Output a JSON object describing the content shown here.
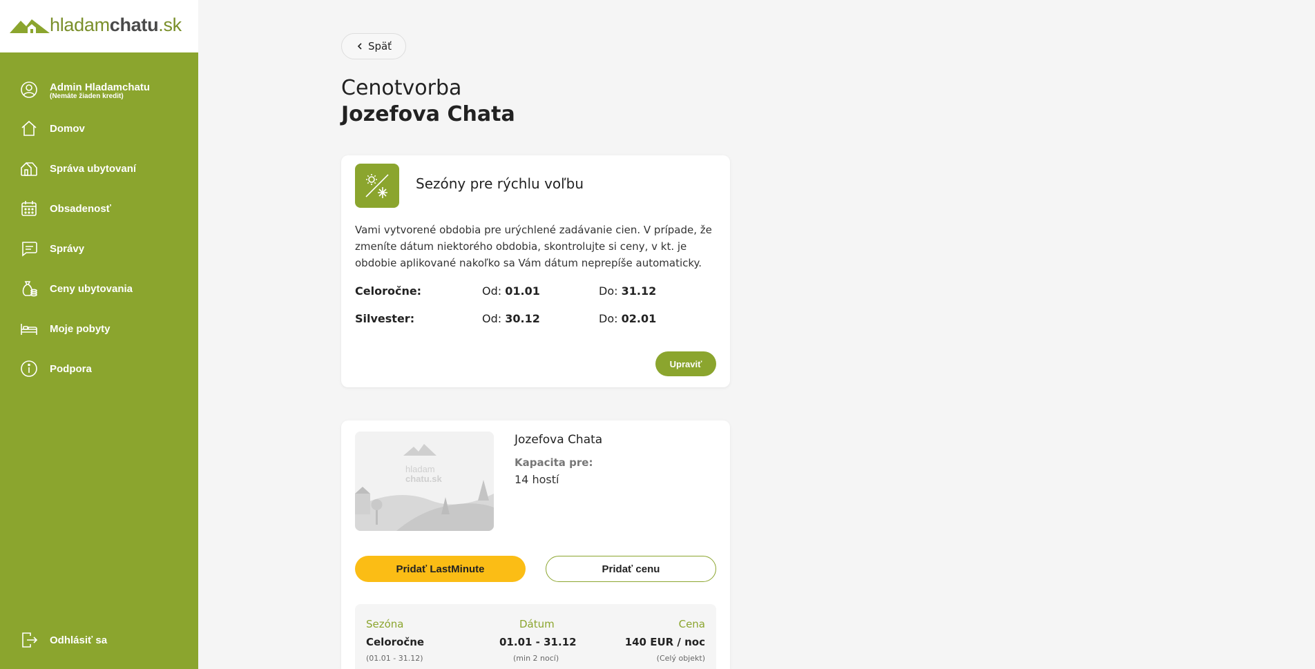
{
  "brand": {
    "logo_light": "hladam",
    "logo_bold": "chatu",
    "logo_tld": ".sk"
  },
  "user": {
    "name": "Admin Hladamchatu",
    "credit": "(Nemáte žiaden kredit)"
  },
  "nav": {
    "home": "Domov",
    "accommodation": "Správa ubytovaní",
    "occupancy": "Obsadenosť",
    "messages": "Správy",
    "prices": "Ceny ubytovania",
    "stays": "Moje pobyty",
    "support": "Podpora",
    "logout": "Odhlásiť sa"
  },
  "back_label": "Späť",
  "page": {
    "title": "Cenotvorba",
    "subtitle": "Jozefova Chata"
  },
  "seasons_card": {
    "title": "Sezóny pre rýchlu voľbu",
    "description": "Vami vytvorené obdobia pre urýchlené zadávanie cien. V prípade, že zmeníte dátum niektorého obdobia, skontrolujte si ceny, v kt. je obdobie aplikované nakoľko sa Vám dátum neprepíše automaticky.",
    "from_label": "Od:",
    "to_label": "Do:",
    "rows": [
      {
        "name": "Celoročne:",
        "from": "01.01",
        "to": "31.12"
      },
      {
        "name": "Silvester:",
        "from": "30.12",
        "to": "02.01"
      }
    ],
    "edit_label": "Upraviť"
  },
  "property": {
    "name": "Jozefova Chata",
    "capacity_label": "Kapacita pre:",
    "capacity_value": "14  hostí",
    "placeholder_logo_1": "hladam",
    "placeholder_logo_2": "chatu.sk"
  },
  "actions": {
    "lastminute": "Pridať LastMinute",
    "add_price": "Pridať cenu"
  },
  "price_table": {
    "headers": {
      "season": "Sezóna",
      "date": "Dátum",
      "price": "Cena"
    },
    "rows": [
      {
        "season": "Celoročne",
        "season_sub": "(01.01  -  31.12)",
        "date": "01.01  -  31.12",
        "date_sub": "(min 2 nocí)",
        "price": "140 EUR / noc",
        "price_sub": "(Celý objekt)"
      }
    ]
  },
  "colors": {
    "brand_green": "#8ba52e",
    "accent_yellow": "#fbbd15"
  }
}
